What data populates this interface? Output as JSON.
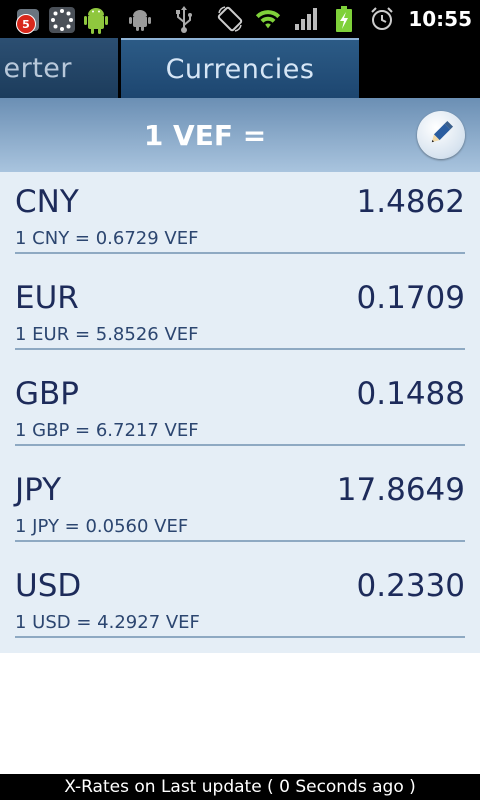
{
  "status_bar": {
    "notification_count": "5",
    "time": "10:55",
    "icons": [
      "notification-app-icon",
      "loading-icon",
      "android-icon",
      "android-debug-icon",
      "usb-icon",
      "rotate-icon",
      "wifi-icon",
      "signal-icon",
      "battery-charging-icon",
      "alarm-icon"
    ]
  },
  "tabs": [
    {
      "label": "Converter",
      "visible_fragment": "erter",
      "active": false
    },
    {
      "label": "Currencies",
      "active": true
    }
  ],
  "header": {
    "title": "1 VEF ="
  },
  "currencies": [
    {
      "code": "CNY",
      "value": "1.4862",
      "sub": "1 CNY = 0.6729 VEF"
    },
    {
      "code": "EUR",
      "value": "0.1709",
      "sub": "1 EUR = 5.8526 VEF"
    },
    {
      "code": "GBP",
      "value": "0.1488",
      "sub": "1 GBP = 6.7217 VEF"
    },
    {
      "code": "JPY",
      "value": "17.8649",
      "sub": "1 JPY = 0.0560 VEF"
    },
    {
      "code": "USD",
      "value": "0.2330",
      "sub": "1 USD = 4.2927 VEF"
    }
  ],
  "footer": {
    "text": "X-Rates on Last update ( 0 Seconds ago )"
  },
  "colors": {
    "accent": "#1d4670",
    "text": "#1d2b5a",
    "list_bg": "#e5eef6"
  }
}
